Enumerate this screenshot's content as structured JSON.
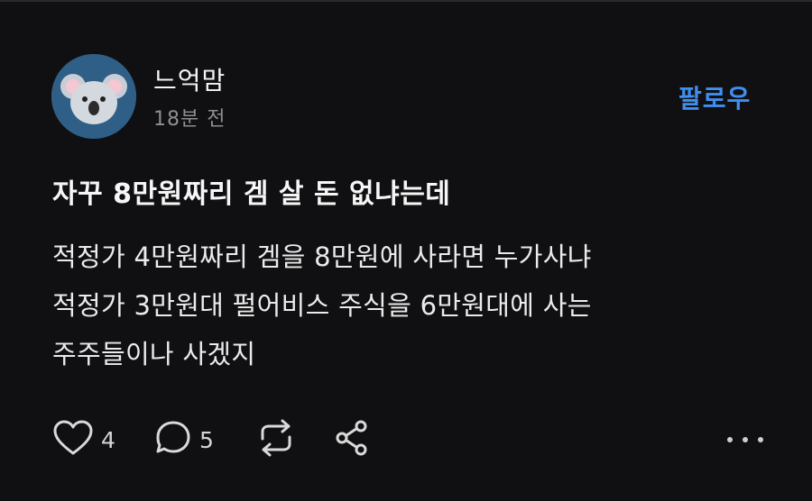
{
  "post": {
    "author": {
      "name": "느억맘",
      "timestamp": "18분 전",
      "avatar_icon": "koala-avatar-icon"
    },
    "follow_label": "팔로우",
    "title": "자꾸 8만원짜리 겜 살 돈 없냐는데",
    "body_lines": [
      "적정가 4만원짜리 겜을 8만원에 사라면 누가사냐",
      "적정가 3만원대 펄어비스 주식을 6만원대에 사는",
      "주주들이나 사겠지"
    ],
    "actions": {
      "like": {
        "icon": "heart-icon",
        "count": "4"
      },
      "comment": {
        "icon": "comment-bubble-icon",
        "count": "5"
      },
      "repost": {
        "icon": "repost-icon"
      },
      "share": {
        "icon": "share-icon"
      },
      "more": {
        "icon": "more-dots-icon"
      }
    }
  },
  "colors": {
    "background": "#101012",
    "accent": "#3f8ff0",
    "muted_text": "#8e8e93",
    "avatar_bg": "#2f5f86"
  }
}
